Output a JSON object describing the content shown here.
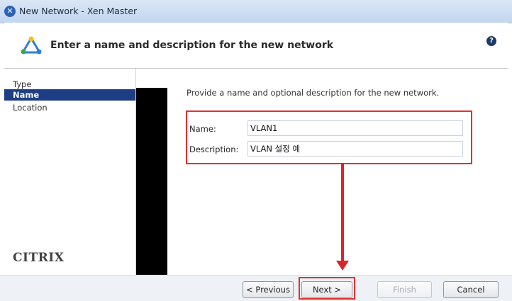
{
  "window": {
    "title": "New Network - Xen Master"
  },
  "header": {
    "heading": "Enter a name and description for the new network",
    "help_symbol": "?"
  },
  "sidebar": {
    "items": [
      {
        "label": "Type",
        "active": false
      },
      {
        "label": "Name",
        "active": true
      },
      {
        "label": "Location",
        "active": false
      }
    ],
    "logo_text": "CITRIX"
  },
  "main": {
    "intro": "Provide a name and optional description for the new network.",
    "name_label": "Name:",
    "name_value": "VLAN1",
    "description_label": "Description:",
    "description_value": "VLAN 설정 예"
  },
  "footer": {
    "previous_label": "< Previous",
    "next_label": "Next >",
    "finish_label": "Finish",
    "cancel_label": "Cancel"
  },
  "annotation_color": "#e23030"
}
